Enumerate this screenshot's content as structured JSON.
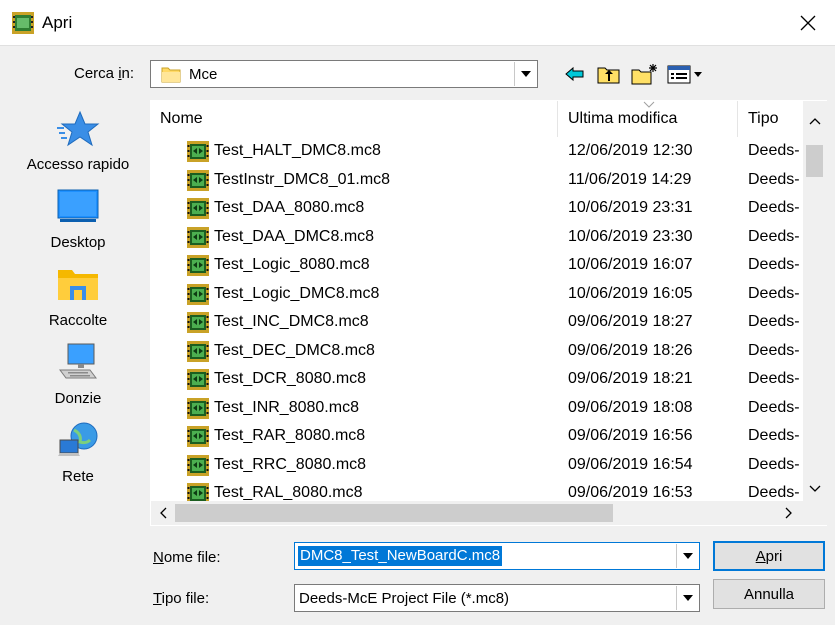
{
  "window": {
    "title": "Apri",
    "app_icon": "dip-chip-icon",
    "close_icon": "close-icon"
  },
  "lookin": {
    "label_pre": "Cerca ",
    "label_key": "i",
    "label_post": "n:",
    "value": "Mce",
    "icon": "folder-icon"
  },
  "toolbar": {
    "back_icon": "back-arrow-icon",
    "up_icon": "up-folder-icon",
    "new_folder_icon": "new-folder-icon",
    "view_menu_icon": "view-menu-icon"
  },
  "places": [
    {
      "label": "Accesso rapido",
      "icon": "star-icon"
    },
    {
      "label": "Desktop",
      "icon": "desktop-icon"
    },
    {
      "label": "Raccolte",
      "icon": "libraries-icon"
    },
    {
      "label": "Donzie",
      "icon": "computer-icon"
    },
    {
      "label": "Rete",
      "icon": "network-icon"
    }
  ],
  "columns": {
    "name": "Nome",
    "modified": "Ultima modifica",
    "type": "Tipo"
  },
  "files": [
    {
      "name": "Test_HALT_DMC8.mc8",
      "modified": "12/06/2019 12:30",
      "type": "Deeds-"
    },
    {
      "name": "TestInstr_DMC8_01.mc8",
      "modified": "11/06/2019 14:29",
      "type": "Deeds-"
    },
    {
      "name": "Test_DAA_8080.mc8",
      "modified": "10/06/2019 23:31",
      "type": "Deeds-"
    },
    {
      "name": "Test_DAA_DMC8.mc8",
      "modified": "10/06/2019 23:30",
      "type": "Deeds-"
    },
    {
      "name": "Test_Logic_8080.mc8",
      "modified": "10/06/2019 16:07",
      "type": "Deeds-"
    },
    {
      "name": "Test_Logic_DMC8.mc8",
      "modified": "10/06/2019 16:05",
      "type": "Deeds-"
    },
    {
      "name": "Test_INC_DMC8.mc8",
      "modified": "09/06/2019 18:27",
      "type": "Deeds-"
    },
    {
      "name": "Test_DEC_DMC8.mc8",
      "modified": "09/06/2019 18:26",
      "type": "Deeds-"
    },
    {
      "name": "Test_DCR_8080.mc8",
      "modified": "09/06/2019 18:21",
      "type": "Deeds-"
    },
    {
      "name": "Test_INR_8080.mc8",
      "modified": "09/06/2019 18:08",
      "type": "Deeds-"
    },
    {
      "name": "Test_RAR_8080.mc8",
      "modified": "09/06/2019 16:56",
      "type": "Deeds-"
    },
    {
      "name": "Test_RRC_8080.mc8",
      "modified": "09/06/2019 16:54",
      "type": "Deeds-"
    },
    {
      "name": "Test_RAL_8080.mc8",
      "modified": "09/06/2019 16:53",
      "type": "Deeds-"
    }
  ],
  "filename": {
    "label_key": "N",
    "label_post": "ome file:",
    "value": "DMC8_Test_NewBoardC.mc8"
  },
  "filetype": {
    "label_key": "T",
    "label_post": "ipo file:",
    "value": "Deeds-McE Project File (*.mc8)"
  },
  "buttons": {
    "open_key": "A",
    "open_post": "pri",
    "cancel": "Annulla"
  },
  "colors": {
    "accent": "#0078d7",
    "window_bg": "#f0f0f0"
  }
}
